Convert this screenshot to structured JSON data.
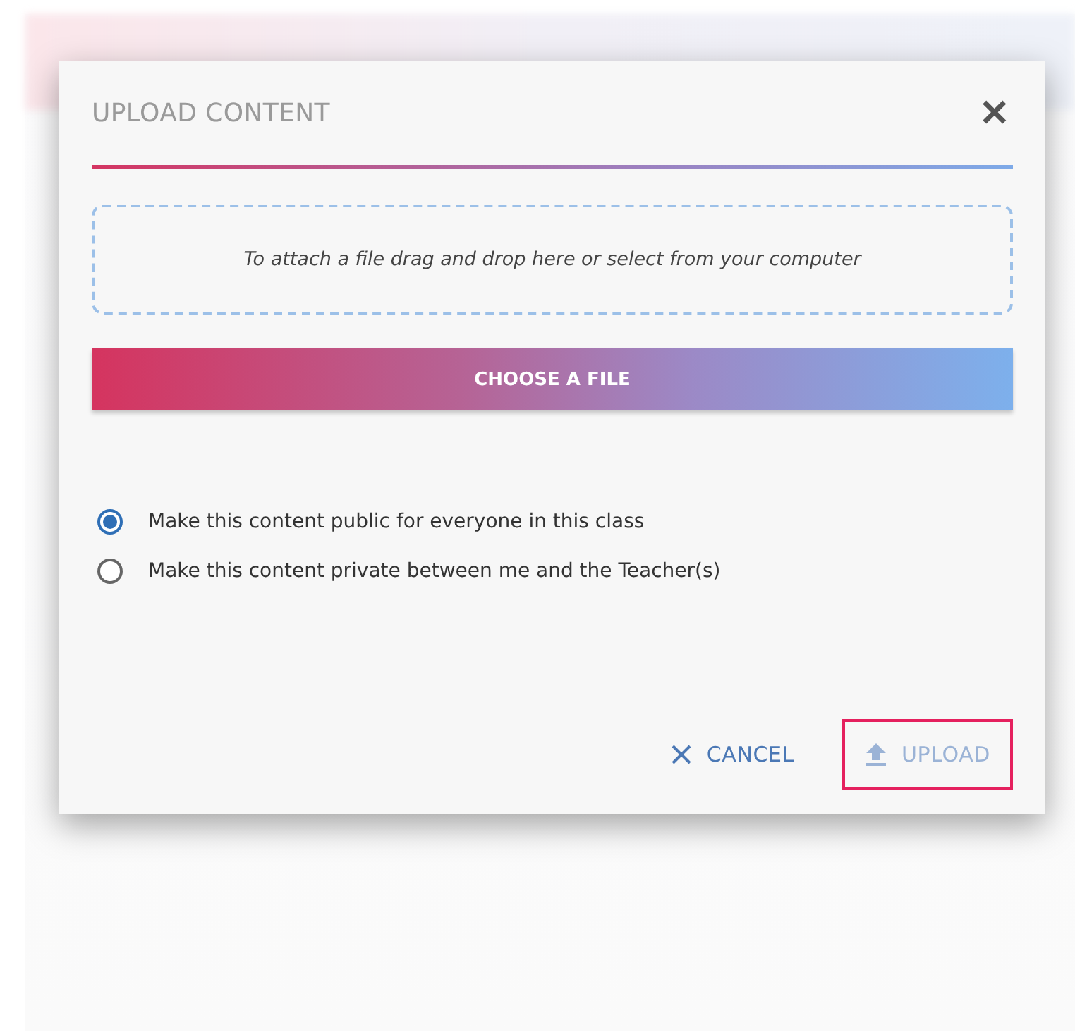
{
  "dialog": {
    "title": "UPLOAD CONTENT",
    "close": "✕",
    "dropzone": {
      "hint": "To attach a file drag and drop here or select from your computer"
    },
    "choose_button": "CHOOSE A FILE",
    "visibility_options": [
      {
        "label": "Make this content public for everyone in this class",
        "selected": true
      },
      {
        "label": "Make this content private between me and the Teacher(s)",
        "selected": false
      }
    ],
    "actions": [
      {
        "kind": "cancel",
        "label": "CANCEL",
        "disabled": false,
        "highlighted": false
      },
      {
        "kind": "upload",
        "label": "UPLOAD",
        "disabled": true,
        "highlighted": true
      }
    ]
  }
}
